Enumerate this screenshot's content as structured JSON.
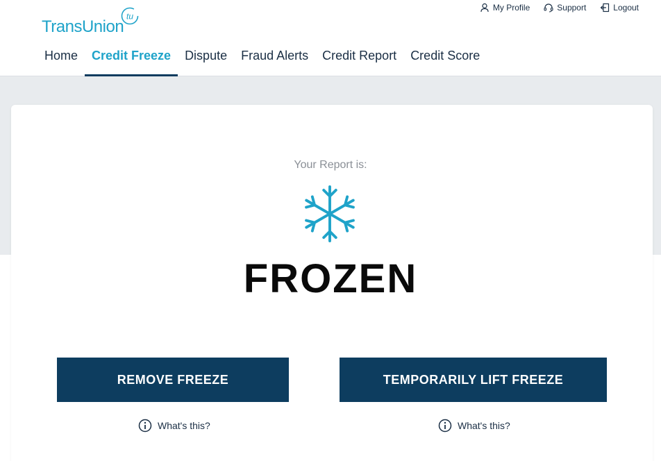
{
  "brand": {
    "logo_text": "TransUnion",
    "logo_mark": "tu",
    "color": "#1fa3c9"
  },
  "utility_nav": [
    {
      "label": "My Profile",
      "icon": "user-icon"
    },
    {
      "label": "Support",
      "icon": "headset-icon"
    },
    {
      "label": "Logout",
      "icon": "logout-icon"
    }
  ],
  "main_nav": [
    {
      "label": "Home",
      "active": false
    },
    {
      "label": "Credit Freeze",
      "active": true
    },
    {
      "label": "Dispute",
      "active": false
    },
    {
      "label": "Fraud Alerts",
      "active": false
    },
    {
      "label": "Credit Report",
      "active": false
    },
    {
      "label": "Credit Score",
      "active": false
    }
  ],
  "status": {
    "label": "Your Report is:",
    "icon": "snowflake-icon",
    "value": "FROZEN"
  },
  "actions": {
    "remove_label": "REMOVE FREEZE",
    "lift_label": "TEMPORARILY LIFT FREEZE",
    "whats_this_remove": "What's this?",
    "whats_this_lift": "What's this?"
  },
  "colors": {
    "accent": "#1fa3c9",
    "button": "#0d3d5f",
    "band": "#e8ebee"
  }
}
